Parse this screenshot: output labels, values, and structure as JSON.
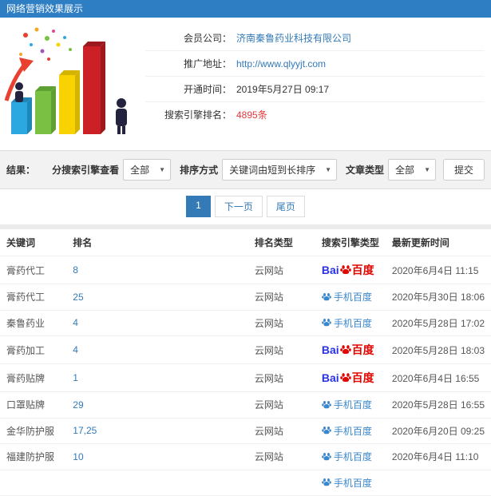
{
  "colors": {
    "titlebar": "#2e7ec4",
    "accent": "#337ab7",
    "highlight_red": "#e4393c",
    "baidu_blue": "#2932e1",
    "baidu_red": "#e10602",
    "mobile_baidu_blue": "#3a87cd"
  },
  "titlebar": {
    "title": "网络营销效果展示"
  },
  "member_info": {
    "fields": [
      {
        "label": "会员公司：",
        "value": "济南秦鲁药业科技有限公司",
        "style": "link"
      },
      {
        "label": "推广地址：",
        "value": "http://www.qlyyjt.com",
        "style": "link"
      },
      {
        "label": "开通时间：",
        "value": "2019年5月27日 09:17",
        "style": "plain"
      },
      {
        "label": "搜索引擎排名：",
        "value": "4895条",
        "style": "red"
      }
    ]
  },
  "filters": {
    "result_label": "结果：",
    "engine_label": "分搜索引擎查看",
    "engine_value": "全部",
    "sort_label": "排序方式",
    "sort_value": "关键词由短到长排序",
    "article_label": "文章类型",
    "article_value": "全部",
    "submit_label": "提交"
  },
  "pagination": {
    "pages": [
      {
        "label": "1",
        "active": true
      },
      {
        "label": "下一页",
        "active": false
      },
      {
        "label": "尾页",
        "active": false
      }
    ]
  },
  "engine_types": {
    "baidu_pc": {
      "logo_bai": "Bai",
      "logo_du": "百度"
    },
    "baidu_mobile": {
      "label": "手机百度"
    }
  },
  "table": {
    "headers": [
      "关键词",
      "排名",
      "排名类型",
      "搜索引擎类型",
      "最新更新时间"
    ],
    "rows": [
      {
        "keyword": "膏药代工",
        "rank": "8",
        "rank_type": "云网站",
        "engine": "baidu_pc",
        "updated": "2020年6月4日 11:15"
      },
      {
        "keyword": "膏药代工",
        "rank": "25",
        "rank_type": "云网站",
        "engine": "baidu_mobile",
        "updated": "2020年5月30日 18:06"
      },
      {
        "keyword": "秦鲁药业",
        "rank": "4",
        "rank_type": "云网站",
        "engine": "baidu_mobile",
        "updated": "2020年5月28日 17:02"
      },
      {
        "keyword": "膏药加工",
        "rank": "4",
        "rank_type": "云网站",
        "engine": "baidu_pc",
        "updated": "2020年5月28日 18:03"
      },
      {
        "keyword": "膏药贴牌",
        "rank": "1",
        "rank_type": "云网站",
        "engine": "baidu_pc",
        "updated": "2020年6月4日 16:55"
      },
      {
        "keyword": "口罩贴牌",
        "rank": "29",
        "rank_type": "云网站",
        "engine": "baidu_mobile",
        "updated": "2020年5月28日 16:55"
      },
      {
        "keyword": "金华防护服",
        "rank": "17,25",
        "rank_type": "云网站",
        "engine": "baidu_mobile",
        "updated": "2020年6月20日 09:25"
      },
      {
        "keyword": "福建防护服",
        "rank": "10",
        "rank_type": "云网站",
        "engine": "baidu_mobile",
        "updated": "2020年6月4日 11:10"
      },
      {
        "keyword": "",
        "rank": "",
        "rank_type": "",
        "engine": "baidu_mobile",
        "updated": ""
      }
    ]
  }
}
